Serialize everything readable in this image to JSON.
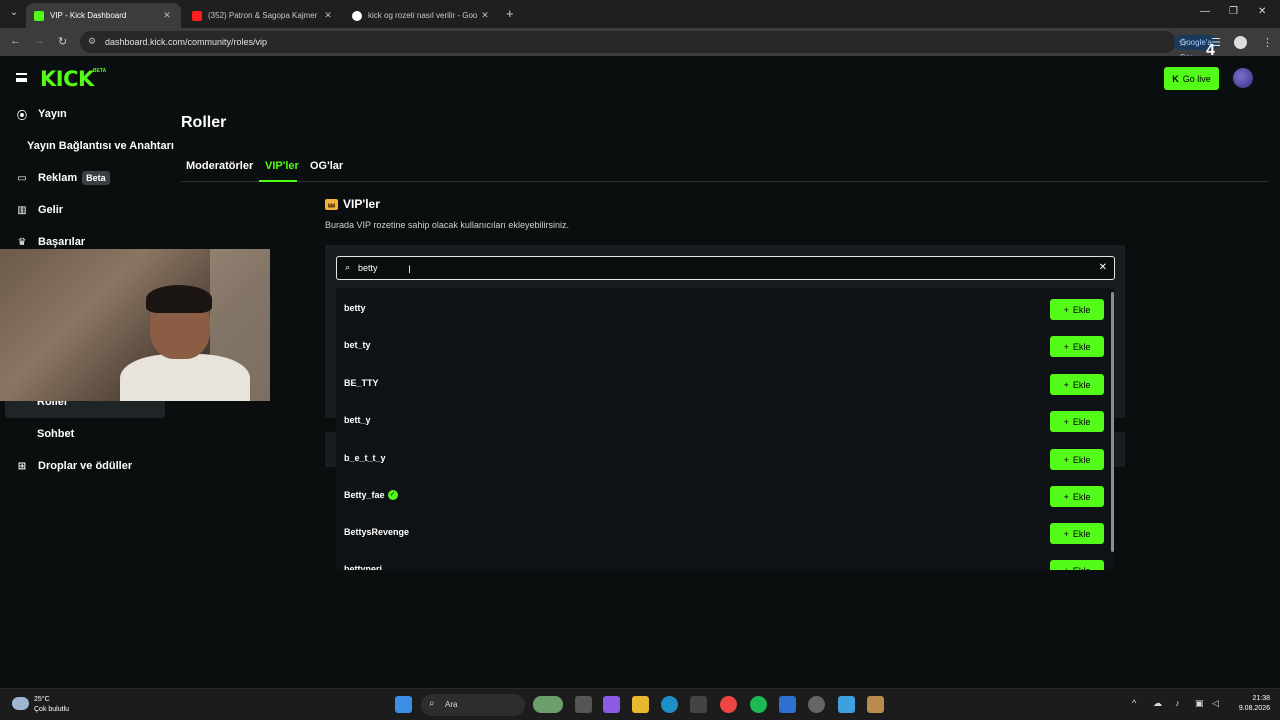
{
  "browser": {
    "tabs": [
      {
        "title": "VIP - Kick Dashboard",
        "active": true,
        "favicon_color": "#53fc18"
      },
      {
        "title": "(352) Patron & Sagopa Kajmer",
        "active": false,
        "favicon_color": "#ff2020"
      },
      {
        "title": "kick og rozeti nasıl verilir - Goo",
        "active": false,
        "favicon_color": "#ffffff"
      }
    ],
    "url": "dashboard.kick.com/community/roles/vip",
    "google_ask": "Google'a Sor",
    "overlay_badge": "4"
  },
  "header": {
    "logo": "KICK",
    "logo_beta": "BETA",
    "go_live": "Go live"
  },
  "sidebar": {
    "items": [
      {
        "label": "Yayın",
        "icon": "broadcast-icon"
      },
      {
        "label": "Yayın Bağlantısı ve Anahtarı",
        "sub": true
      },
      {
        "label": "Reklam",
        "badge": "Beta",
        "icon": "ad-icon"
      },
      {
        "label": "Gelir",
        "icon": "chart-icon"
      },
      {
        "label": "Başarılar",
        "icon": "trophy-icon"
      },
      {
        "label": "Roller",
        "sub": true,
        "active": true
      },
      {
        "label": "Sohbet",
        "sub": true
      },
      {
        "label": "Droplar ve ödüller",
        "icon": "drops-icon"
      }
    ]
  },
  "main": {
    "title": "Roller",
    "tabs": [
      {
        "label": "Moderatörler",
        "active": false
      },
      {
        "label": "VIP'ler",
        "active": true
      },
      {
        "label": "OG'lar",
        "active": false
      }
    ],
    "section_title": "VIP'ler",
    "section_desc": "Burada VIP rozetine sahip olacak kullanıcıları ekleyebilirsiniz.",
    "search_value": "betty",
    "add_label": "Ekle",
    "results": [
      {
        "name": "betty",
        "verified": false
      },
      {
        "name": "bet_ty",
        "verified": false
      },
      {
        "name": "BE_TTY",
        "verified": false
      },
      {
        "name": "bett_y",
        "verified": false
      },
      {
        "name": "b_e_t_t_y",
        "verified": false
      },
      {
        "name": "Betty_fae",
        "verified": true
      },
      {
        "name": "BettysRevenge",
        "verified": false
      },
      {
        "name": "bettyneri",
        "verified": false
      }
    ]
  },
  "taskbar": {
    "temp": "25°C",
    "weather": "Çok bulutlu",
    "search": "Ara",
    "time": "21:38",
    "date": "9.08.2026"
  },
  "colors": {
    "accent": "#53fc18",
    "bg": "#0b0e0f",
    "panel": "#191d20"
  }
}
